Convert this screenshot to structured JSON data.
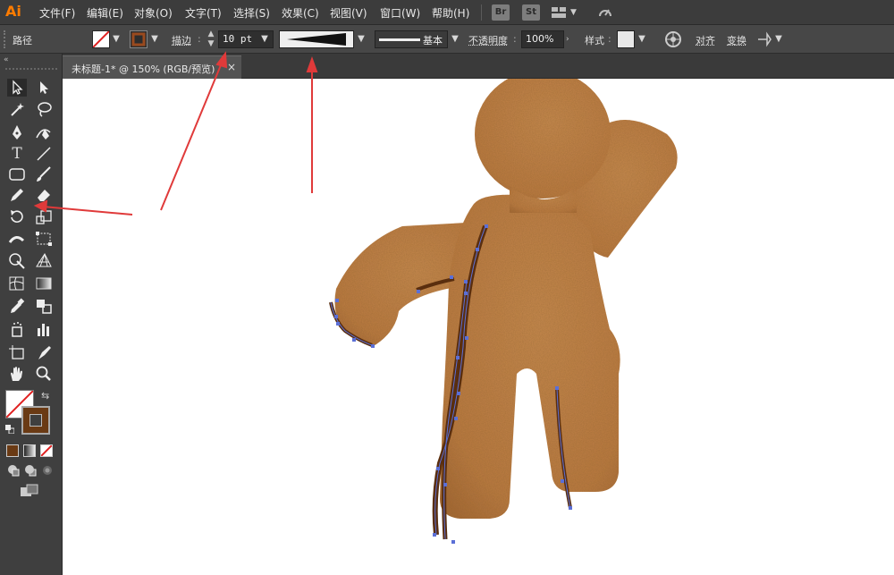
{
  "app": {
    "logo": "Ai"
  },
  "menu": [
    "文件(F)",
    "编辑(E)",
    "对象(O)",
    "文字(T)",
    "选择(S)",
    "效果(C)",
    "视图(V)",
    "窗口(W)",
    "帮助(H)"
  ],
  "menubar_badges": {
    "bridge": "Br",
    "stock": "St"
  },
  "control": {
    "selection_type": "路径",
    "stroke_label": "描边",
    "stroke_weight": "10 pt",
    "brush_label": "基本",
    "opacity_label": "不透明度",
    "opacity_value": "100%",
    "style_label": "样式",
    "align_label": "对齐",
    "transform_label": "变换",
    "colors": {
      "stroke_swatch": "#7a3b12",
      "fill_none": "#ffffff"
    }
  },
  "document": {
    "tab_title": "未标题-1* @ 150% (RGB/预览)",
    "close_glyph": "×"
  },
  "colors": {
    "ui_dark": "#3c3c3c",
    "canvas": "#ffffff",
    "cookie_body": "#c07f46",
    "crack_stroke": "#5a2e0e",
    "anchor_point": "#5b6fd6",
    "annotation_arrow": "#e03a3a"
  },
  "icons": [
    "selection-tool-icon",
    "direct-selection-tool-icon",
    "magic-wand-icon",
    "lasso-icon",
    "pen-tool-icon",
    "curvature-tool-icon",
    "type-tool-icon",
    "line-segment-icon",
    "rectangle-tool-icon",
    "paintbrush-icon",
    "pencil-icon",
    "eraser-icon",
    "rotate-icon",
    "scale-icon",
    "width-tool-icon",
    "free-transform-icon",
    "shape-builder-icon",
    "perspective-grid-icon",
    "mesh-icon",
    "gradient-icon",
    "eyedropper-icon",
    "blend-icon",
    "symbol-sprayer-icon",
    "column-graph-icon",
    "artboard-icon",
    "slice-icon",
    "hand-icon",
    "zoom-icon"
  ]
}
